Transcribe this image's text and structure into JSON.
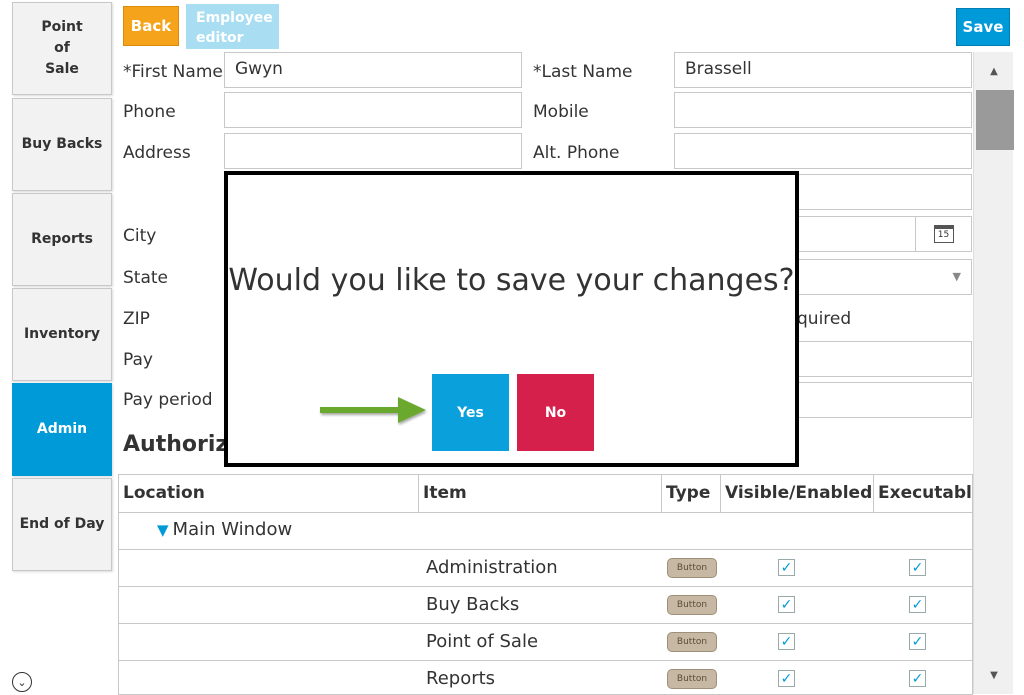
{
  "sidebar": {
    "items": [
      {
        "label": "Point\nof\nSale"
      },
      {
        "label": "Buy Backs"
      },
      {
        "label": "Reports"
      },
      {
        "label": "Inventory"
      },
      {
        "label": "Admin"
      },
      {
        "label": "End of Day"
      }
    ],
    "active_index": 4
  },
  "toolbar": {
    "back_label": "Back",
    "editor_label": "Employee editor",
    "save_label": "Save"
  },
  "form": {
    "first_name_label": "*First Name",
    "first_name_value": "Gwyn",
    "last_name_label": "*Last Name",
    "last_name_value": "Brassell",
    "phone_label": "Phone",
    "mobile_label": "Mobile",
    "address_label": "Address",
    "alt_phone_label": "Alt. Phone",
    "city_label": "City",
    "state_label": "State",
    "zip_label": "ZIP",
    "pay_label": "Pay",
    "pay_period_label": "Pay period",
    "required_partial": "quired",
    "authorizations_partial": "Authoriza",
    "calendar_day": "15"
  },
  "table": {
    "columns": [
      "Location",
      "Item",
      "Type",
      "Visible/Enabled",
      "Executable"
    ],
    "group": "Main Window",
    "rows": [
      {
        "item": "Administration",
        "type": "Button",
        "visible": true,
        "executable": true
      },
      {
        "item": "Buy Backs",
        "type": "Button",
        "visible": true,
        "executable": true
      },
      {
        "item": "Point of Sale",
        "type": "Button",
        "visible": true,
        "executable": true
      },
      {
        "item": "Reports",
        "type": "Button",
        "visible": true,
        "executable": true
      }
    ]
  },
  "modal": {
    "question": "Would you like to save your changes?",
    "yes_label": "Yes",
    "no_label": "No"
  },
  "colors": {
    "accent": "#009ad9",
    "back": "#f5a31a",
    "no": "#d4204b",
    "arrow": "#6aa82f"
  }
}
